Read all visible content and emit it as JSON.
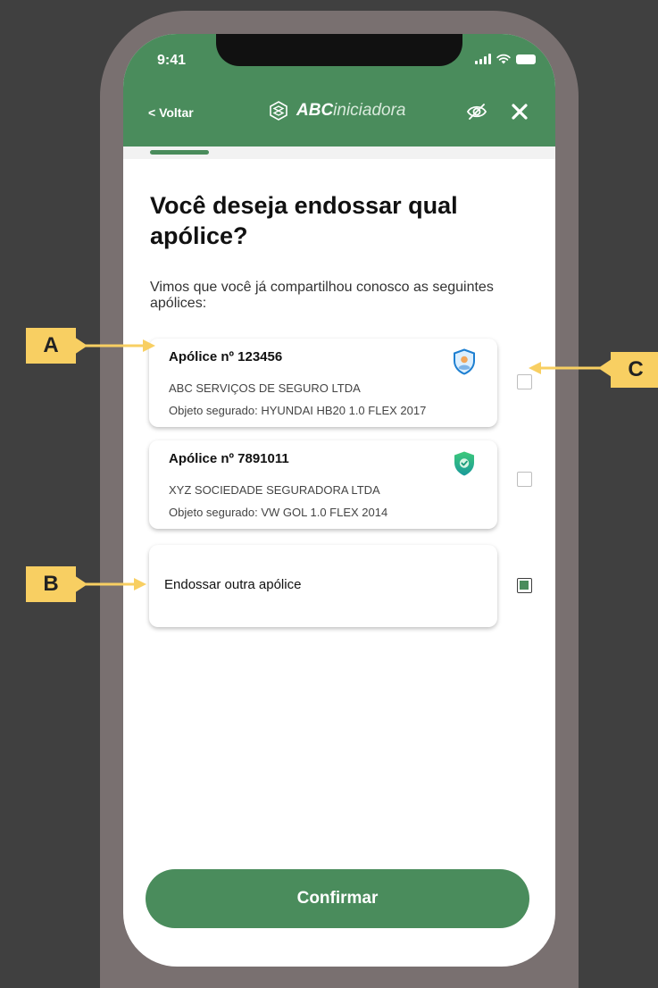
{
  "status_bar": {
    "time": "9:41"
  },
  "header": {
    "back_label": "< Voltar",
    "brand_bold": "ABC",
    "brand_light": "iniciadora"
  },
  "main": {
    "title": "Você deseja endossar qual apólice?",
    "subtitle": "Vimos que você já compartilhou conosco as seguintes apólices:",
    "policies": [
      {
        "title": "Apólice nº 123456",
        "insurer": "ABC SERVIÇOS DE SEGURO LTDA",
        "object": "Objeto segurado: HYUNDAI HB20 1.0 FLEX 2017",
        "icon": "shield-user-icon",
        "checked": false
      },
      {
        "title": "Apólice nº 7891011",
        "insurer": "XYZ SOCIEDADE SEGURADORA LTDA",
        "object": "Objeto segurado: VW GOL 1.0 FLEX 2014",
        "icon": "shield-check-icon",
        "checked": false
      }
    ],
    "other_option": {
      "label": "Endossar outra apólice",
      "checked": true
    },
    "confirm_label": "Confirmar"
  },
  "annotations": {
    "a": "A",
    "b": "B",
    "c": "C"
  },
  "colors": {
    "brand_green": "#4a8c5c",
    "background": "#404040",
    "phone_frame": "#797070",
    "annotation_yellow": "#f8cf62"
  }
}
